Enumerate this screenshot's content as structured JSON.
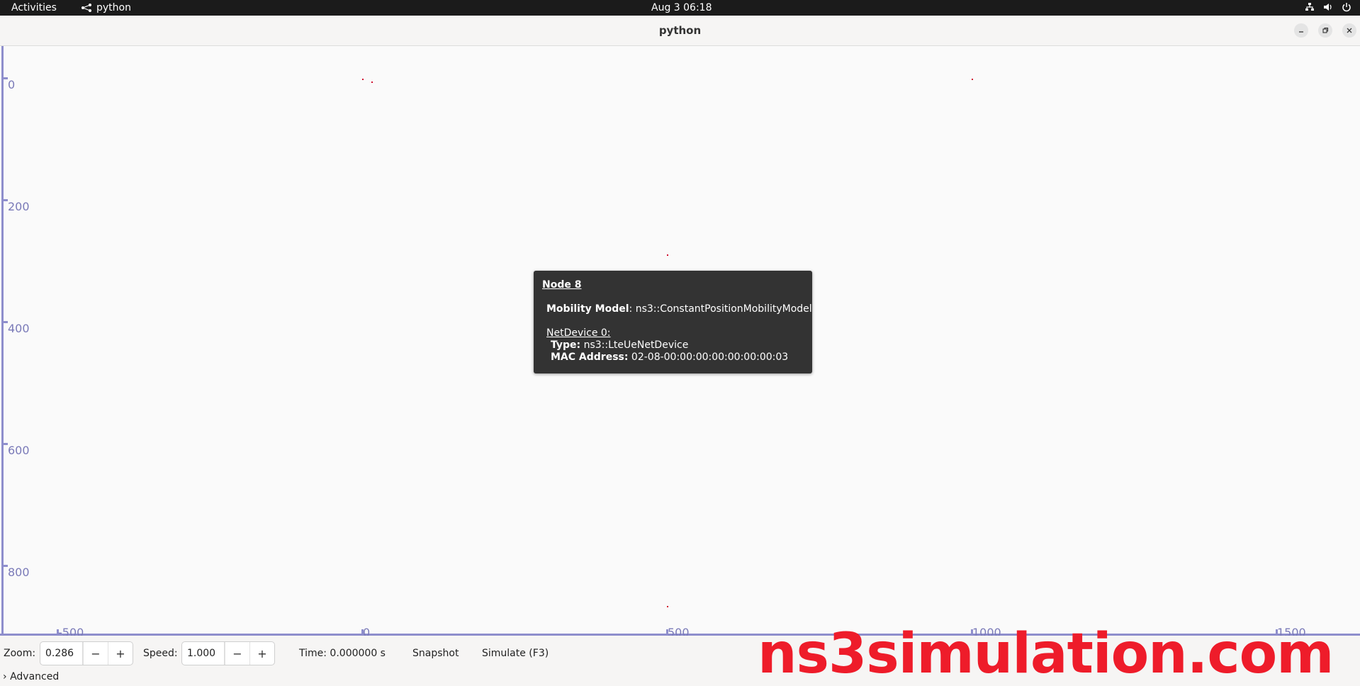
{
  "topbar": {
    "activities": "Activities",
    "app_name": "python",
    "clock": "Aug 3  06:18"
  },
  "window": {
    "title": "python"
  },
  "canvas": {
    "y_ticks": [
      "0",
      "200",
      "400",
      "600",
      "800"
    ],
    "x_ticks": [
      "-500",
      "0",
      "500",
      "1000",
      "1500"
    ]
  },
  "tooltip": {
    "title": "Node 8",
    "mobility_label": "Mobility Model",
    "mobility_value": ": ns3::ConstantPositionMobilityModel",
    "netdevice_label": "NetDevice 0:",
    "type_label": "Type:",
    "type_value": " ns3::LteUeNetDevice",
    "mac_label": "MAC Address:",
    "mac_value": " 02-08-00:00:00:00:00:00:00:03"
  },
  "toolbar": {
    "zoom_label": "Zoom:",
    "zoom_value": "0.286",
    "speed_label": "Speed:",
    "speed_value": "1.000",
    "minus": "−",
    "plus": "+",
    "time_text": "Time: 0.000000 s",
    "snapshot_label": "Snapshot",
    "simulate_label": "Simulate (F3)",
    "advanced_label": "Advanced",
    "advanced_arrow": "›"
  },
  "watermark": "ns3simulation.com",
  "colors": {
    "axis": "#8e8ecc",
    "node": "#d01030",
    "watermark": "#ee1c2a"
  }
}
